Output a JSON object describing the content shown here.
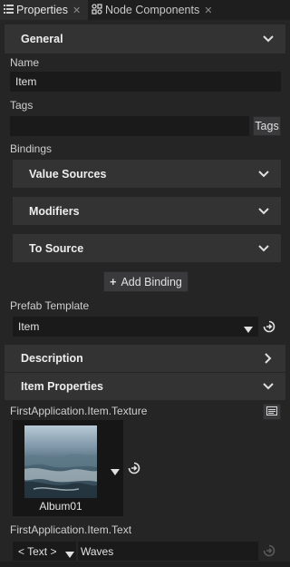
{
  "tabs": [
    {
      "label": "Properties",
      "icon": "list-icon"
    },
    {
      "label": "Node Components",
      "icon": "node-components-icon"
    }
  ],
  "general": {
    "title": "General",
    "name_label": "Name",
    "name_value": "Item",
    "tags_label": "Tags",
    "tags_value": "",
    "tags_button": "Tags",
    "bindings_label": "Bindings",
    "value_sources": "Value Sources",
    "modifiers": "Modifiers",
    "to_source": "To Source",
    "add_binding": "Add Binding",
    "prefab_label": "Prefab Template",
    "prefab_value": "Item"
  },
  "description": {
    "title": "Description"
  },
  "item_properties": {
    "title": "Item Properties",
    "texture_label": "FirstApplication.Item.Texture",
    "texture_name": "Album01",
    "text_label": "FirstApplication.Item.Text",
    "text_type": "< Text >",
    "text_value": "Waves"
  },
  "colors": {
    "background": "#252526",
    "section": "#333334",
    "field": "#1a1a1a"
  }
}
